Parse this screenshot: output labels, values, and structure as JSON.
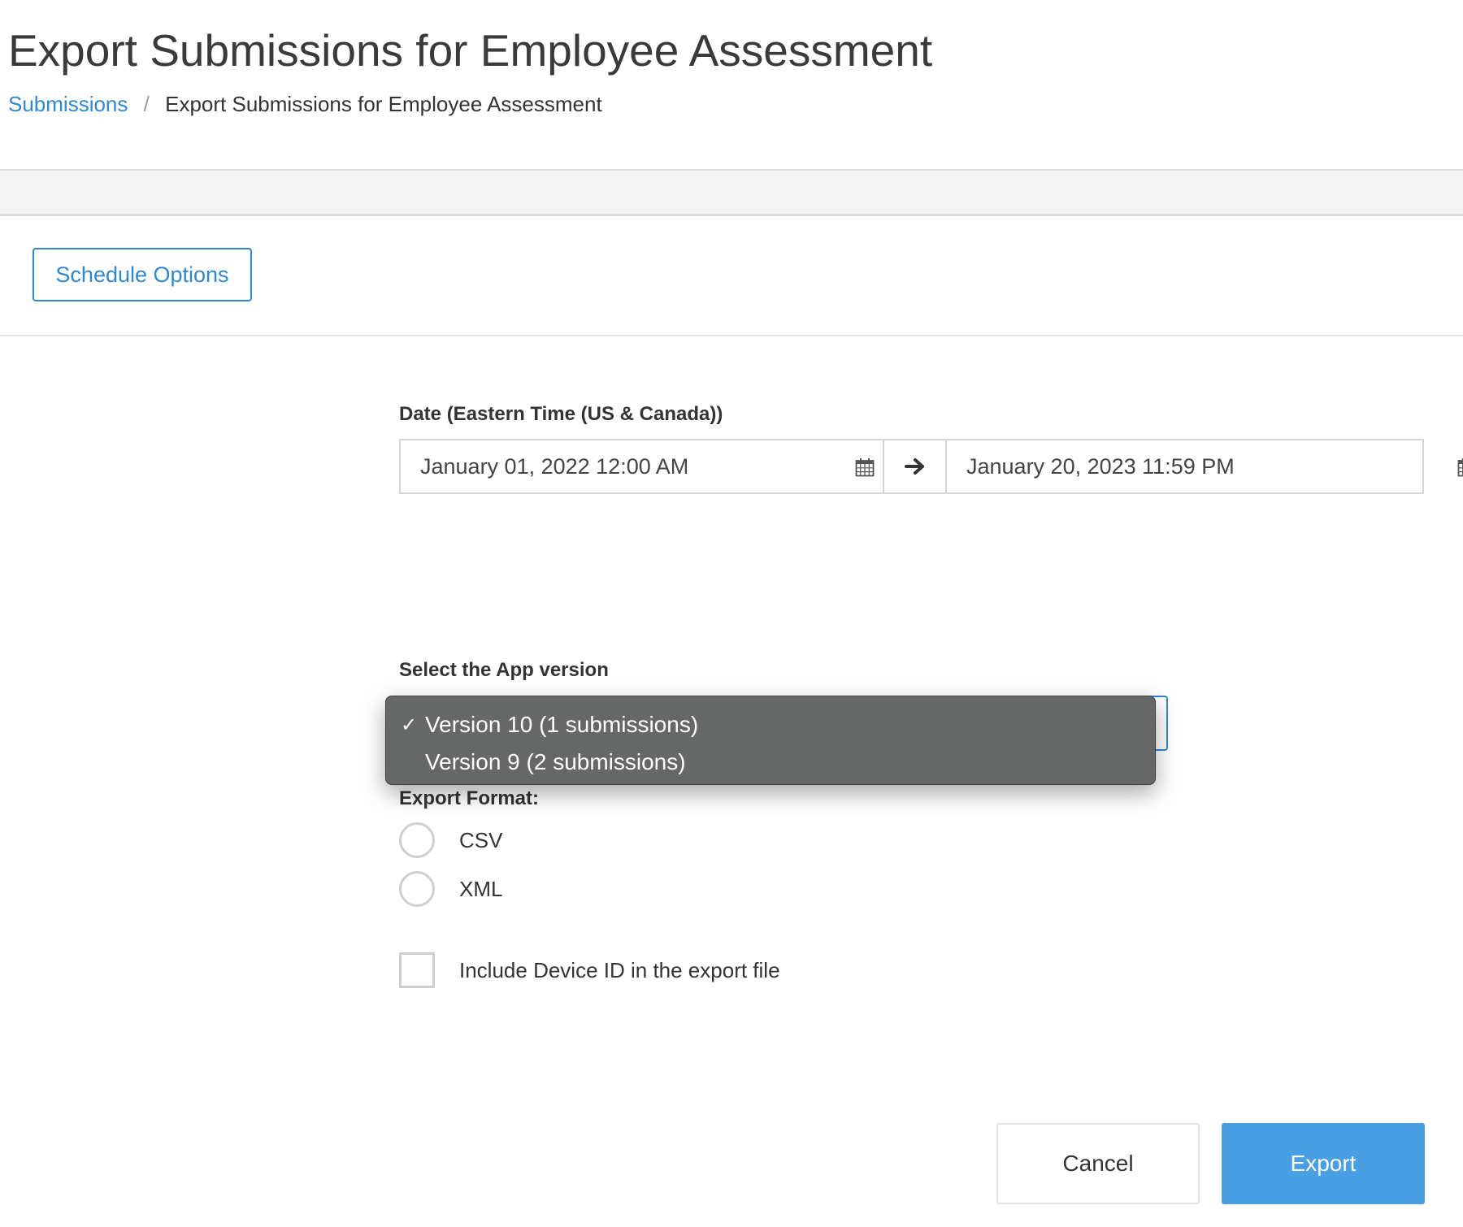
{
  "header": {
    "title": "Export Submissions for Employee Assessment",
    "breadcrumb": {
      "link": "Submissions",
      "separator": "/",
      "current": "Export Submissions for Employee Assessment"
    }
  },
  "toolbar": {
    "schedule_label": "Schedule Options"
  },
  "date_filter": {
    "label": "Date (Eastern Time (US & Canada))",
    "start": "January 01, 2022 12:00 AM",
    "end": "January 20, 2023 11:59 PM",
    "start_icon": "calendar-icon",
    "arrow_icon": "arrow-right-icon",
    "end_icon": "calendar-icon"
  },
  "app_version": {
    "label": "Select the App version",
    "options": [
      {
        "label": "Version 10 (1 submissions)",
        "selected": true
      },
      {
        "label": "Version 9 (2 submissions)",
        "selected": false
      }
    ],
    "check_mark": "✓"
  },
  "export_format": {
    "label": "Export Format:",
    "options": [
      "CSV",
      "XML"
    ]
  },
  "device_id": {
    "label": "Include Device ID in the export file",
    "checked": false
  },
  "actions": {
    "cancel_label": "Cancel",
    "export_label": "Export"
  },
  "colors": {
    "accent": "#2d88d6",
    "export_button": "#4a9fe3",
    "dropdown_bg": "#666767",
    "band_bg": "#f3f3f3"
  }
}
